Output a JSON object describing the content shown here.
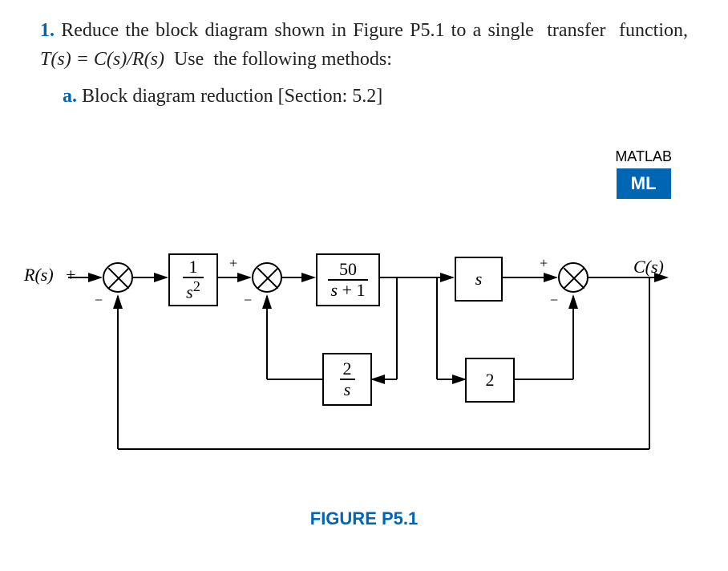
{
  "problem": {
    "number": "1.",
    "text_part1": "Reduce the block diagram shown in Figure P5.1 to a single  transfer  function,",
    "text_tf": "T(s) = C(s)/R(s)",
    "text_part2": " Use  the following methods:",
    "sub_label": "a.",
    "sub_text": "Block diagram reduction [Section: 5.2]"
  },
  "matlab": {
    "label": "MATLAB",
    "badge": "ML"
  },
  "diagram": {
    "input_label": "R(s)",
    "output_label": "C(s)",
    "block_g1_num": "1",
    "block_g1_den": "s²",
    "block_g2_num": "50",
    "block_g2_den": "s + 1",
    "block_g3": "s",
    "block_h1_num": "2",
    "block_h1_den": "s",
    "block_h2": "2",
    "sum1_plus": "+",
    "sum1_minus": "−",
    "sum2_plus": "+",
    "sum2_minus": "−",
    "sum3_plus": "+",
    "sum3_minus": "−"
  },
  "figure_caption": "FIGURE P5.1",
  "chart_data": {
    "type": "block-diagram",
    "input": "R(s)",
    "output": "C(s)",
    "sum_junctions": [
      {
        "id": "S1",
        "inputs": [
          {
            "from": "R(s)",
            "sign": "+"
          },
          {
            "from": "C(s)",
            "sign": "-",
            "feedback": true
          }
        ]
      },
      {
        "id": "S2",
        "inputs": [
          {
            "from": "G1",
            "sign": "+"
          },
          {
            "from": "H1",
            "sign": "-",
            "feedback": true
          }
        ]
      },
      {
        "id": "S3",
        "inputs": [
          {
            "from": "G3",
            "sign": "+"
          },
          {
            "from": "H2",
            "sign": "-",
            "feedback": true
          }
        ]
      }
    ],
    "blocks": [
      {
        "id": "G1",
        "tf": "1/s^2",
        "from": "S1",
        "to": "S2"
      },
      {
        "id": "G2",
        "tf": "50/(s+1)",
        "from": "S2",
        "to": "node_mid"
      },
      {
        "id": "G3",
        "tf": "s",
        "from": "node_mid",
        "to": "S3"
      },
      {
        "id": "H1",
        "tf": "2/s",
        "from": "node_mid",
        "to": "S2",
        "feedback": true
      },
      {
        "id": "H2",
        "tf": "2",
        "from": "node_mid",
        "to": "S3",
        "feedback": true
      }
    ],
    "output_from": "S3",
    "outer_unity_feedback": {
      "from": "C(s)",
      "to": "S1",
      "sign": "-"
    }
  }
}
